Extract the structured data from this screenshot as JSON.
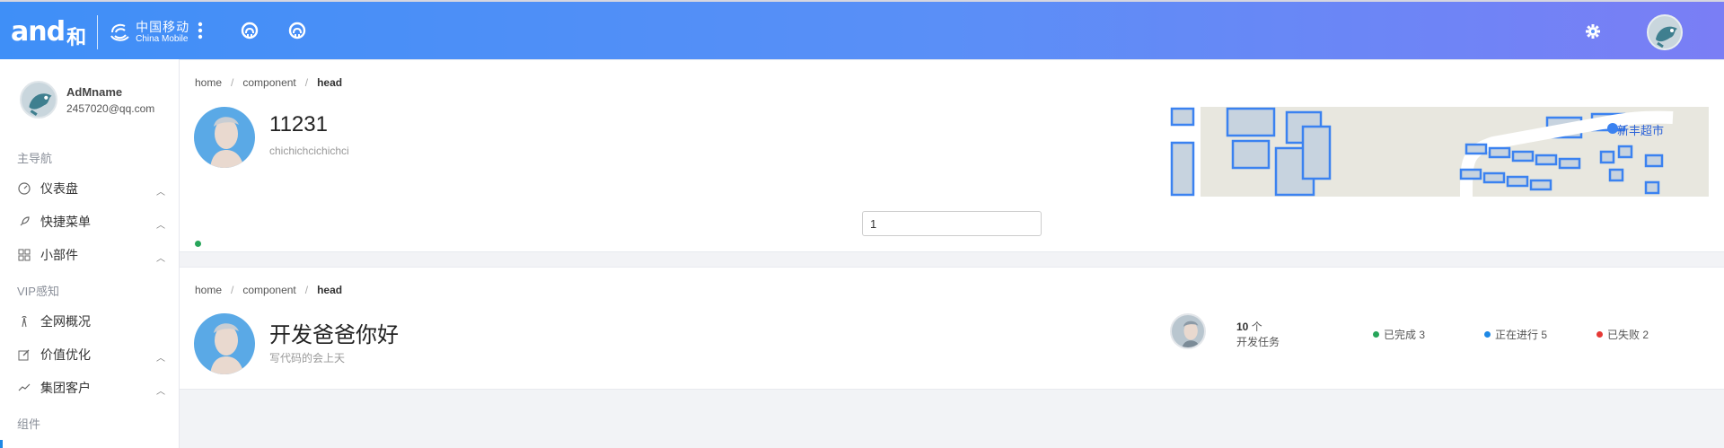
{
  "header": {
    "logo_text": "and",
    "logo_cn": "和",
    "brand_cn": "中国移动",
    "brand_en": "China Mobile",
    "icons": [
      "more-vertical-icon",
      "github-icon",
      "github-icon",
      "gear-icon",
      "avatar"
    ]
  },
  "sidebar": {
    "user": {
      "name": "AdMname",
      "email": "2457020@qq.com"
    },
    "groups": [
      "主导航",
      "VIP感知",
      "组件"
    ],
    "items": [
      {
        "label": "仪表盘",
        "icon": "dashboard-icon"
      },
      {
        "label": "快捷菜单",
        "icon": "rocket-icon"
      },
      {
        "label": "小部件",
        "icon": "grid-icon"
      },
      {
        "label": "全网概况",
        "icon": "tower-icon"
      },
      {
        "label": "价值优化",
        "icon": "edit-icon"
      },
      {
        "label": "集团客户",
        "icon": "line-chart-icon"
      }
    ]
  },
  "card1": {
    "breadcrumb": [
      "home",
      "component",
      "head"
    ],
    "title": "11231",
    "subtitle": "chichichcichichci",
    "map_label": "新丰超市",
    "input_value": "1"
  },
  "card2": {
    "breadcrumb": [
      "home",
      "component",
      "head"
    ],
    "title": "开发爸爸你好",
    "subtitle": "写代码的会上天",
    "task_count": "10",
    "task_unit": "个",
    "task_label": "开发任务",
    "stats": [
      {
        "label": "已完成 3",
        "color": "#27a55a"
      },
      {
        "label": "正在进行 5",
        "color": "#1e88e5"
      },
      {
        "label": "已失败 2",
        "color": "#e53935"
      }
    ]
  },
  "colors": {
    "header_start": "#3f8ff7",
    "header_end": "#7a7ef5",
    "accent": "#1e88e5"
  }
}
